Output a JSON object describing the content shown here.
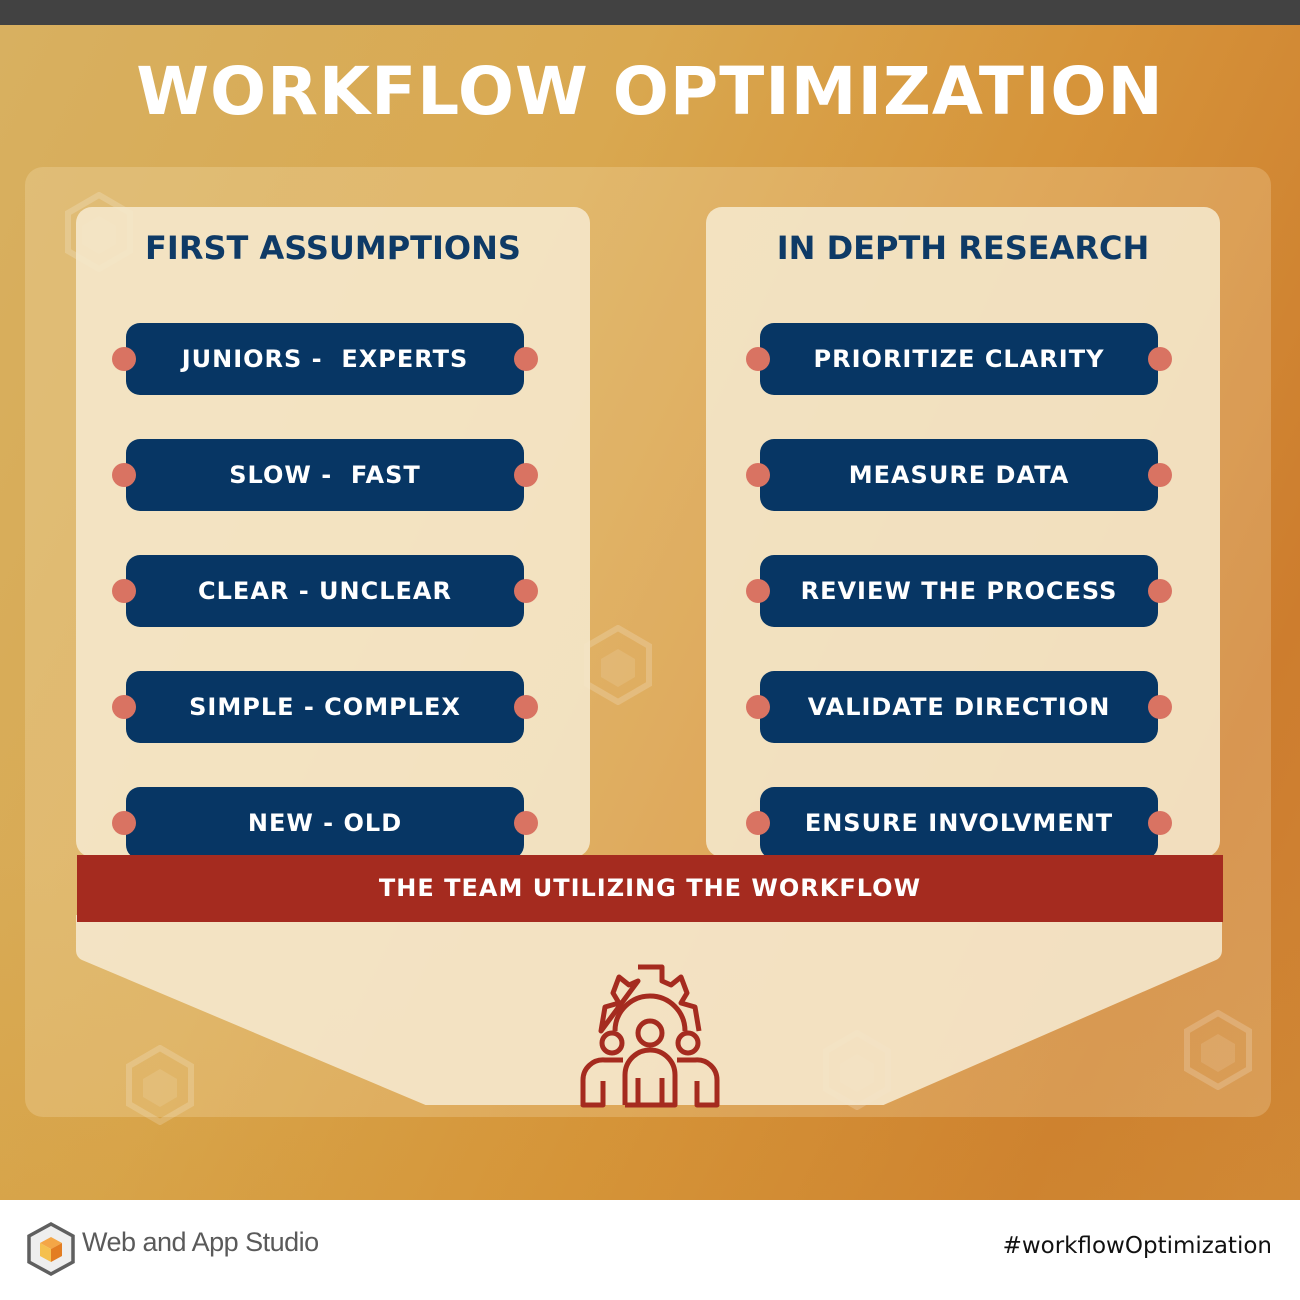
{
  "title": "WORKFLOW OPTIMIZATION",
  "colors": {
    "navy": "#073664",
    "accent_red": "#a52b1f",
    "connector_dot": "#d97362",
    "background_orange": "#d6943a"
  },
  "columns": [
    {
      "heading": "FIRST ASSUMPTIONS",
      "items": [
        "JUNIORS -  EXPERTS",
        "SLOW -  FAST",
        "CLEAR - UNCLEAR",
        "SIMPLE - COMPLEX",
        "NEW - OLD"
      ]
    },
    {
      "heading": "IN DEPTH RESEARCH",
      "items": [
        "PRIORITIZE CLARITY",
        "MEASURE DATA",
        "REVIEW THE PROCESS",
        "VALIDATE DIRECTION",
        "ENSURE INVOLVMENT"
      ]
    }
  ],
  "banner": "THE TEAM UTILIZING THE WORKFLOW",
  "icon": "team-gear-icon",
  "footer": {
    "brand": "Web and App Studio",
    "hashtag": "#workflowOptimization"
  }
}
